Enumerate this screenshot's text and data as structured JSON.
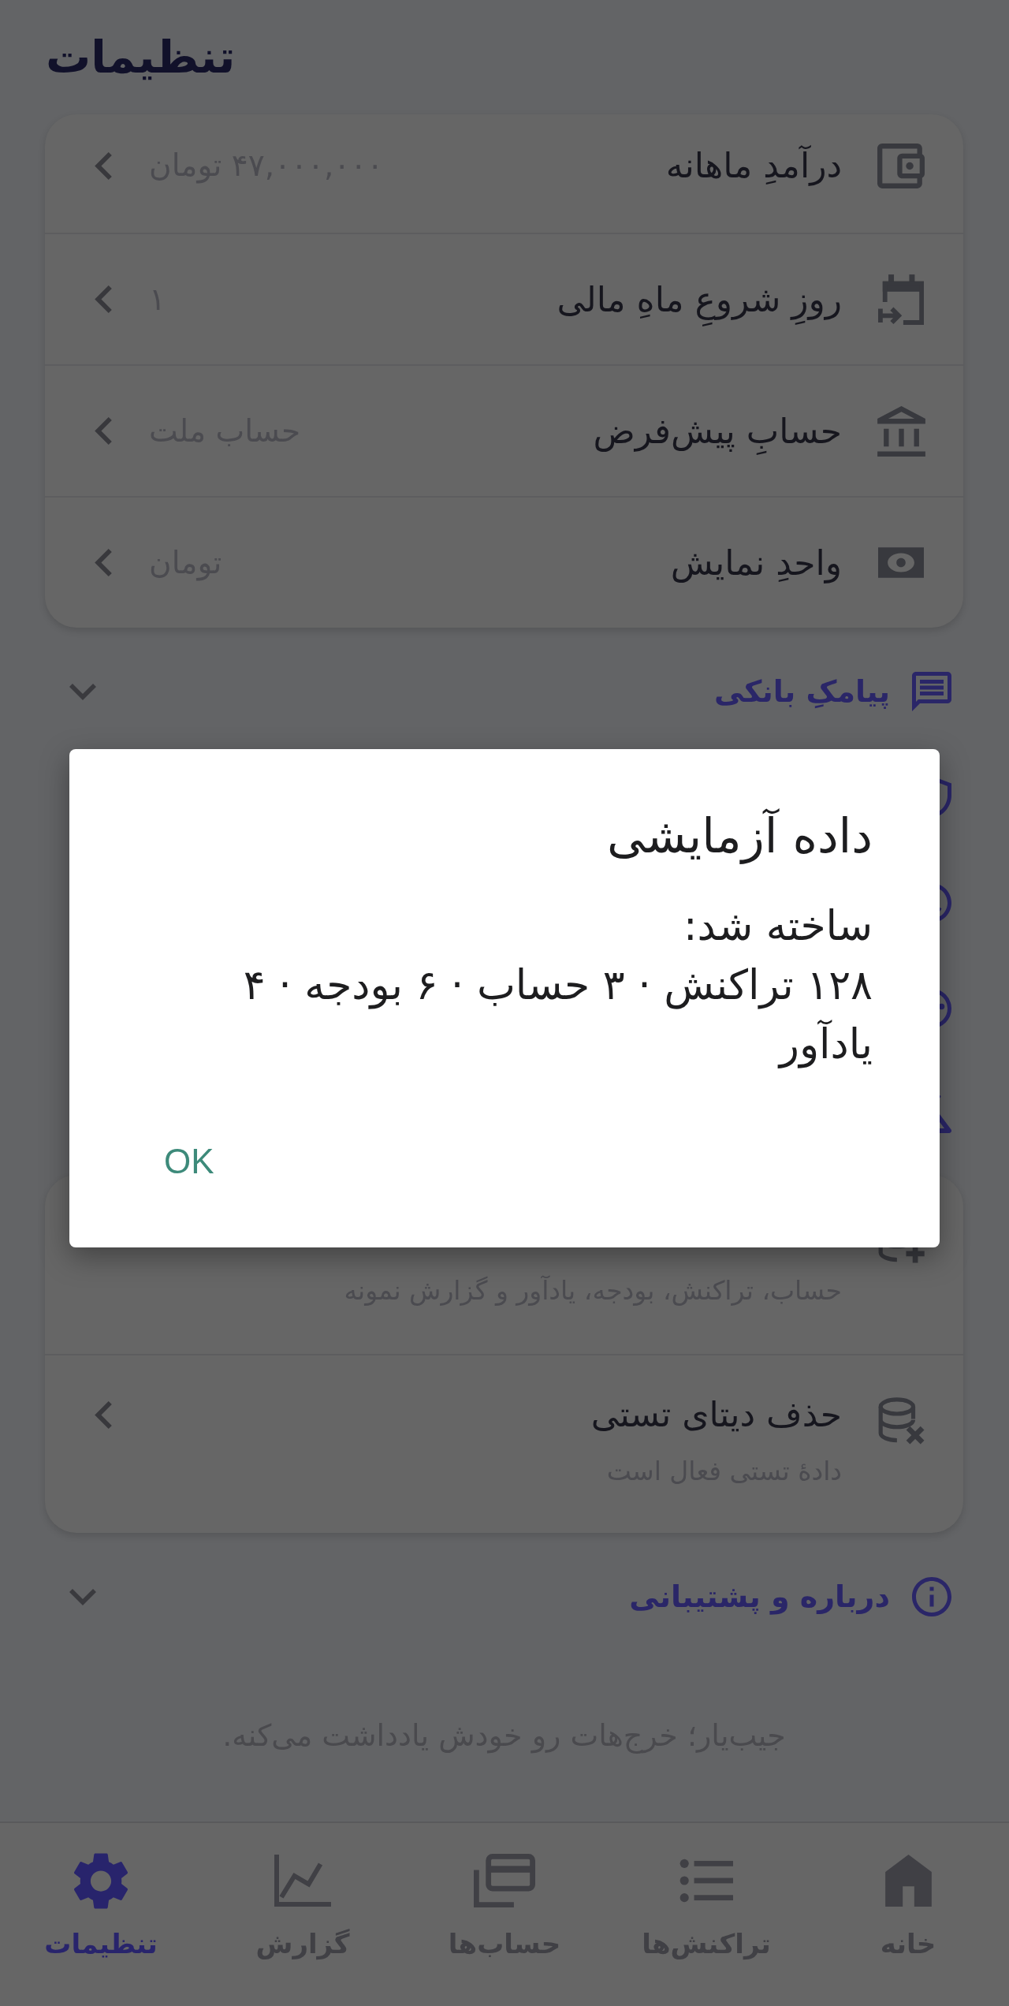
{
  "app_bar": {
    "title": "تنظیمات"
  },
  "settings_card": {
    "rows": [
      {
        "title": "درآمدِ ماهانه",
        "value": "۴۷,۰۰۰,۰۰۰ تومان"
      },
      {
        "title": "روزِ شروعِ ماهِ مالی",
        "value": "۱"
      },
      {
        "title": "حسابِ پیش‌فرض",
        "value": "حساب ملت"
      },
      {
        "title": "واحدِ نمایش",
        "value": "تومان"
      }
    ]
  },
  "sections": [
    {
      "kind": "header",
      "title": "پیامکِ بانکی",
      "expanded": false
    },
    {
      "kind": "covered"
    },
    {
      "kind": "covered"
    },
    {
      "kind": "covered"
    },
    {
      "kind": "covered",
      "expanded": true,
      "rows": [
        {
          "subtitle": "حساب، تراکنش، بودجه، یادآور و گزارش نمونه"
        },
        {
          "title": "حذف دیتای تستی",
          "subtitle": "دادهٔ تستی فعال است"
        }
      ]
    },
    {
      "kind": "header",
      "title": "درباره و پشتیبانی",
      "expanded": false
    }
  ],
  "footer": {
    "tagline": "جیب‌یار؛ خرج‌هات رو خودش یادداشت می‌کنه."
  },
  "bottom_nav": [
    {
      "label": "خانه",
      "selected": false
    },
    {
      "label": "تراکنش‌ها",
      "selected": false
    },
    {
      "label": "حساب‌ها",
      "selected": false
    },
    {
      "label": "گزارش",
      "selected": false
    },
    {
      "label": "تنظیمات",
      "selected": true
    }
  ],
  "dialog": {
    "title": "داده آزمایشی",
    "message": "ساخته شد:\n۱۲۸ تراکنش · ۳ حساب · ۶ بودجه · ۴ یادآور",
    "buttons": [
      "OK"
    ]
  }
}
